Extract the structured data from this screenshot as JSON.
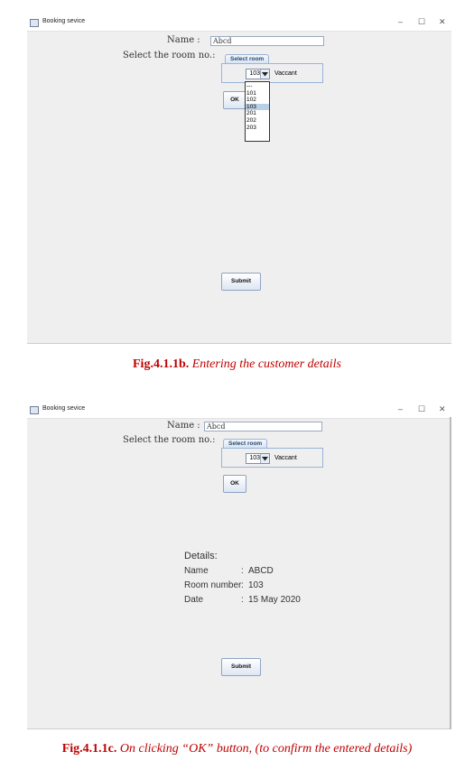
{
  "fig_b": {
    "window_title": "Booking sevice",
    "name_label": "Name :",
    "name_value": "Abcd",
    "room_label": "Select the room no.:",
    "group_title": "Select room",
    "combo_value": "103",
    "status": "Vaccant",
    "ok_label": "OK",
    "dropdown_items": [
      "---",
      "101",
      "102",
      "103",
      "201",
      "202",
      "203"
    ],
    "dropdown_selected": "103",
    "submit_label": "Submit",
    "caption_bold": "Fig.4.1.1b.",
    "caption_text": "Entering the customer details"
  },
  "fig_c": {
    "window_title": "Booking sevice",
    "name_label": "Name :",
    "name_value": "Abcd",
    "room_label": "Select the room no.:",
    "group_title": "Select room",
    "combo_value": "103",
    "status": "Vaccant",
    "ok_label": "OK",
    "details_heading": "Details:",
    "details": [
      {
        "key": "Name",
        "sep": ":",
        "value": "ABCD"
      },
      {
        "key": "Room number",
        "sep": ":",
        "value": "103"
      },
      {
        "key": "Date",
        "sep": ":",
        "value": "15 May 2020"
      }
    ],
    "submit_label": "Submit",
    "caption_bold": "Fig.4.1.1c.",
    "caption_text": "On clicking “OK” button, (to confirm the entered details)"
  },
  "window_controls": {
    "minimize": "–",
    "maximize": "☐",
    "close": "✕"
  }
}
